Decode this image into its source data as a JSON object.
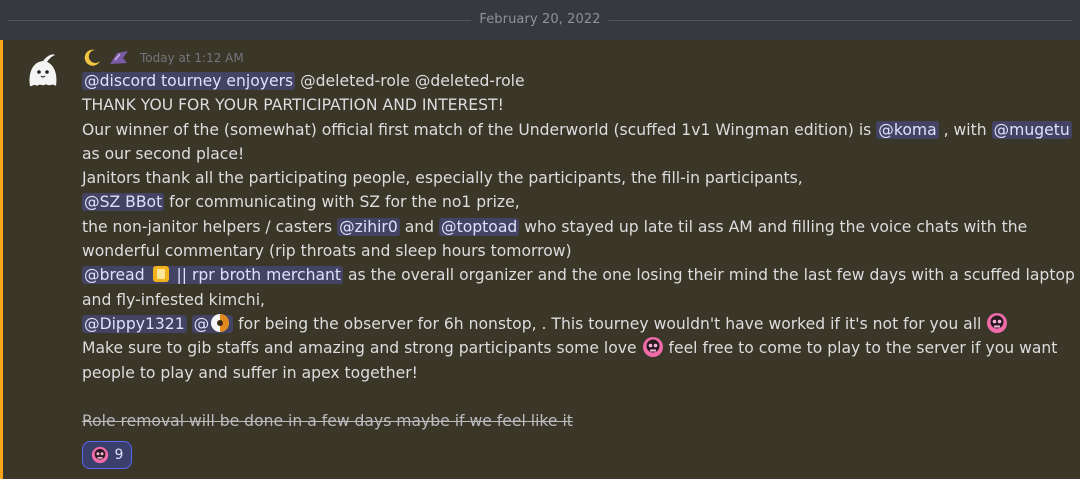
{
  "divider": {
    "date": "February 20, 2022"
  },
  "message": {
    "timestamp": "Today at 1:12 AM",
    "lines": {
      "l1": {
        "m1": "@discord tourney enjoyers",
        "t1": " @deleted-role @deleted-role"
      },
      "l2": "THANK YOU FOR YOUR PARTICIPATION AND INTEREST!",
      "l3": {
        "t1": "Our winner of the (somewhat) official first match of the Underworld (scuffed 1v1 Wingman edition) is ",
        "m1": "@koma",
        "t2": " , with ",
        "m2": "@mugetu"
      },
      "l4": "as our second place!",
      "l5": "Janitors thank all the participating people, especially the participants, the fill-in participants,",
      "l6": {
        "m1": "@SZ BBot",
        "t1": " for communicating with SZ for the no1 prize,"
      },
      "l7": {
        "t1": "the non-janitor helpers / casters ",
        "m1": "@zihir0",
        "t2": " and ",
        "m2": "@toptoad",
        "t3": " who stayed up late til ass AM and filling the voice chats with the"
      },
      "l8": "wonderful commentary (rip throats and sleep hours tomorrow)",
      "l9": {
        "m1a": "@bread ",
        "m1b": " || rpr broth merchant",
        "t1": " as the overall organizer and the one losing their mind the last few days with a scuffed laptop"
      },
      "l10": "and fly-infested kimchi,",
      "l11": {
        "m1": "@Dippy1321",
        "m2": "@",
        "t1": " for being the observer for 6h nonstop, . This tourney wouldn't have worked if it's not for you all "
      },
      "l12": {
        "t1": "Make sure to gib staffs and amazing and strong participants some love ",
        "t2": " feel free to come to play to the server if you want"
      },
      "l13": "people to play and suffer in apex together!",
      "l15": "Role removal will be done in a few days maybe if we feel like it"
    },
    "reaction": {
      "emoji": "pink-skull-emoji",
      "count": "9"
    }
  },
  "colors": {
    "background": "#36393f",
    "highlight": "#faa61a",
    "mention_bg": "#4b5080",
    "mention_text": "#dee0fc"
  }
}
